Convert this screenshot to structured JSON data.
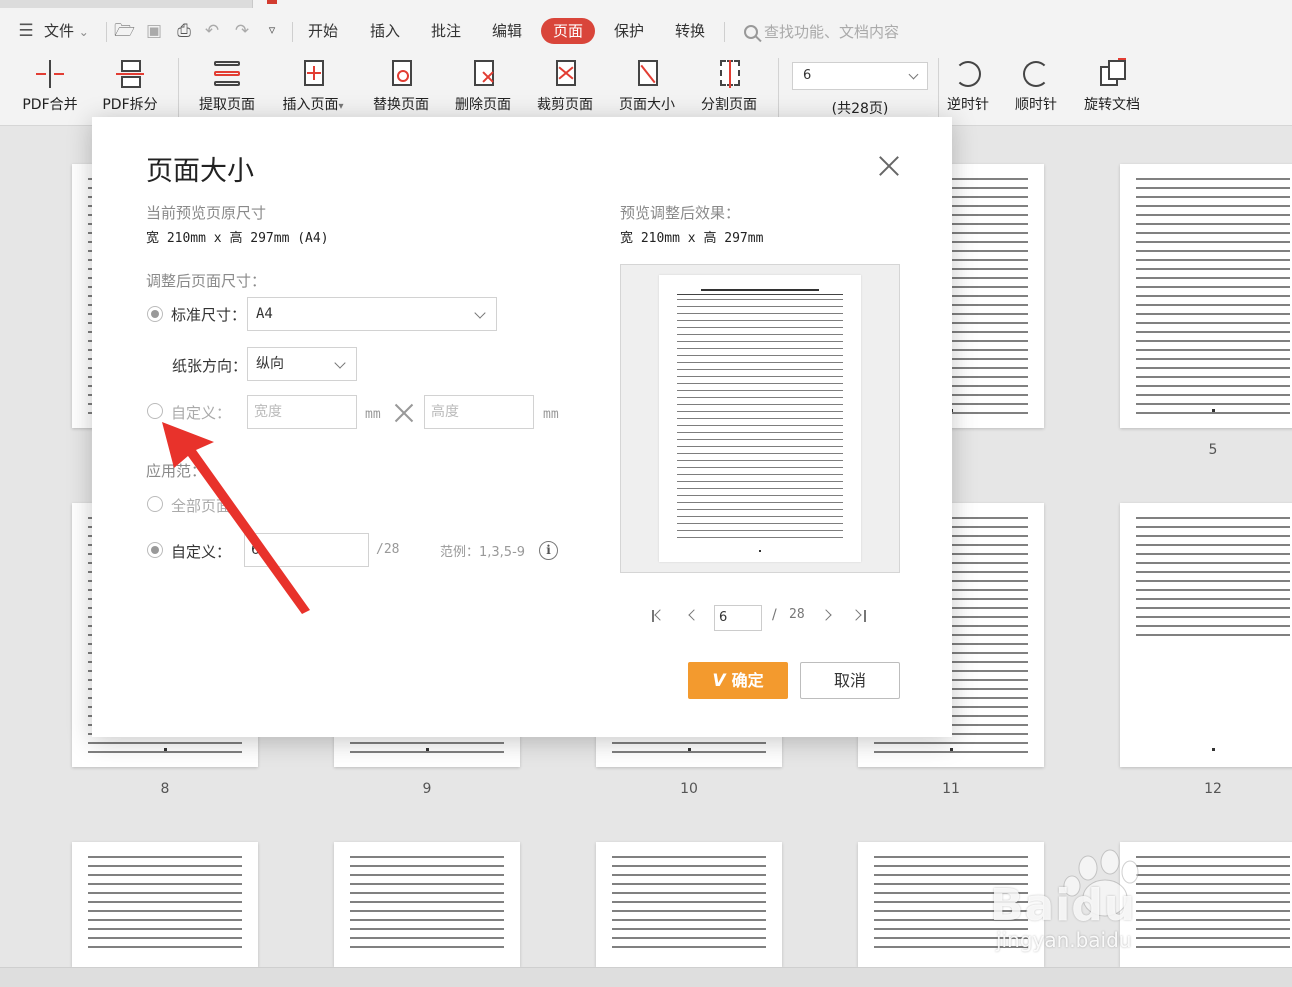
{
  "menu": {
    "file": "文件",
    "tabs": [
      "开始",
      "插入",
      "批注",
      "编辑",
      "页面",
      "保护",
      "转换"
    ],
    "active_tab": "页面",
    "search_placeholder": "查找功能、文档内容"
  },
  "ribbon": {
    "buttons": [
      "PDF合并",
      "PDF拆分",
      "提取页面",
      "插入页面",
      "替换页面",
      "删除页面",
      "裁剪页面",
      "页面大小",
      "分割页面",
      "逆时针",
      "顺时针",
      "旋转文档"
    ],
    "insert_dropdown": "▾",
    "page_select_value": "6",
    "page_total": "(共28页)"
  },
  "thumbnails": {
    "page_numbers": [
      "5",
      "8",
      "9",
      "10",
      "11",
      "12"
    ]
  },
  "dialog": {
    "title": "页面大小",
    "current_label": "当前预览页原尺寸",
    "current_size": "宽 210mm x 高 297mm (A4)",
    "preview_label": "预览调整后效果：",
    "preview_size": "宽 210mm x 高 297mm",
    "adjusted_label": "调整后页面尺寸：",
    "standard_label": "标准尺寸：",
    "standard_value": "A4",
    "orientation_label": "纸张方向：",
    "orientation_value": "纵向",
    "custom_label": "自定义：",
    "width_placeholder": "宽度",
    "height_placeholder": "高度",
    "unit": "mm",
    "apply_label": "应用范",
    "apply_label_tail": "：",
    "all_pages_label": "全部页",
    "all_pages_tail": "面",
    "range_custom_label": "自定义：",
    "range_value": "6",
    "range_total": "/28",
    "example": "范例：1,3,5-9",
    "pager_current": "6",
    "pager_sep": "/",
    "pager_total": "28",
    "ok": "确定",
    "ok_vip": "V",
    "cancel": "取消"
  },
  "watermark": {
    "brand": "Baidu",
    "sub": "jingyan.baidu"
  },
  "colors": {
    "accent": "#d9453a",
    "ok_button": "#f39a2e",
    "arrow": "#e8322b"
  }
}
